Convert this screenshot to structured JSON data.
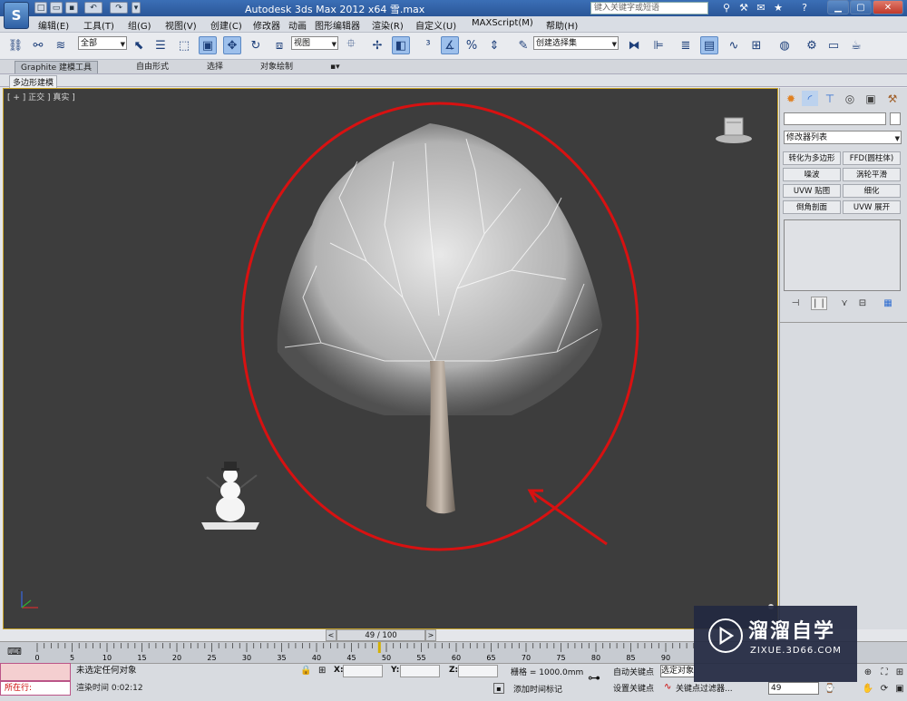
{
  "window": {
    "title": "Autodesk 3ds Max  2012 x64      雪.max",
    "help_search_placeholder": "键入关键字或短语"
  },
  "menu": [
    "编辑(E)",
    "工具(T)",
    "组(G)",
    "视图(V)",
    "创建(C)",
    "修改器",
    "动画",
    "图形编辑器",
    "渲染(R)",
    "自定义(U)",
    "MAXScript(M)",
    "帮助(H)"
  ],
  "toolbar": {
    "selection_filter": "全部",
    "reference_coord": "视图",
    "named_selection": "创建选择集"
  },
  "ribbon": {
    "tabs": [
      "Graphite 建模工具",
      "自由形式",
      "选择",
      "对象绘制"
    ],
    "panel_label": "多边形建模"
  },
  "viewport": {
    "label": "[ + ] 正交 ] 真实 ]",
    "highlight_color": "#d81111",
    "arrow_color": "#d81111"
  },
  "command_panel": {
    "modifier_list": "修改器列表",
    "modifier_buttons": [
      "转化为多边形",
      "FFD(圆柱体)",
      "噪波",
      "涡轮平滑",
      "UVW 贴图",
      "细化",
      "倒角剖面",
      "UVW 展开"
    ]
  },
  "timeline": {
    "slider_text": "49 / 100",
    "current_frame": 49,
    "ticks": [
      "0",
      "5",
      "10",
      "15",
      "20",
      "25",
      "30",
      "35",
      "40",
      "45",
      "50",
      "55",
      "60",
      "65",
      "70",
      "75",
      "80",
      "85",
      "90"
    ]
  },
  "status": {
    "maxscript_status": "所在行:",
    "message": "未选定任何对象",
    "prompt": "渲染时间  0:02:12",
    "x_label": "X:",
    "y_label": "Y:",
    "z_label": "Z:",
    "grid": "栅格 = 1000.0mm",
    "add_time_tag": "添加时间标记",
    "auto_key": "自动关键点",
    "set_key": "设置关键点",
    "selected_dropdown": "选定对象",
    "key_filters": "关键点过滤器...",
    "frame_value": "49"
  },
  "watermark": {
    "name": "溜溜自学",
    "url": "ZIXUE.3D66.COM"
  }
}
